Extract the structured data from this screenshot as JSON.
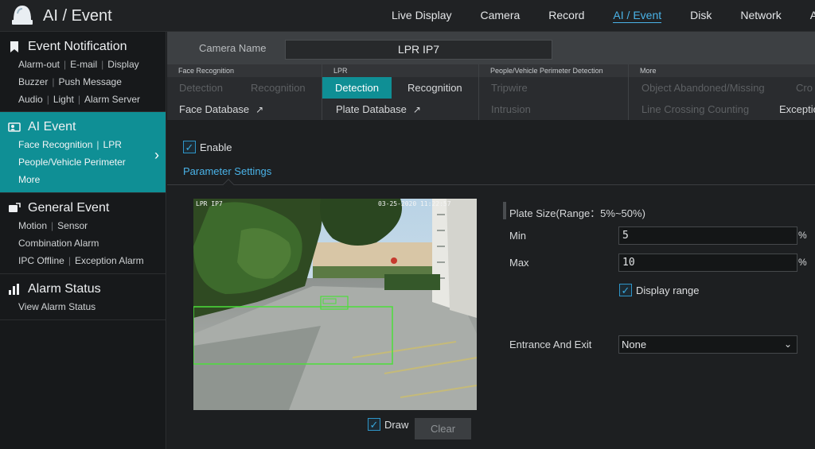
{
  "app": {
    "title": "AI / Event"
  },
  "nav": [
    {
      "label": "Live Display"
    },
    {
      "label": "Camera"
    },
    {
      "label": "Record"
    },
    {
      "label": "AI / Event",
      "active": true
    },
    {
      "label": "Disk"
    },
    {
      "label": "Network"
    },
    {
      "label": "Ac"
    }
  ],
  "sidebar": {
    "event_notification": {
      "title": "Event Notification",
      "links": [
        "Alarm-out",
        "E-mail",
        "Display",
        "Buzzer",
        "Push Message",
        "Audio",
        "Light",
        "Alarm Server"
      ]
    },
    "ai_event": {
      "title": "AI Event",
      "links": [
        "Face Recognition",
        "LPR",
        "People/Vehicle Perimeter",
        "More"
      ]
    },
    "general_event": {
      "title": "General Event",
      "links": [
        "Motion",
        "Sensor",
        "Combination Alarm",
        "IPC Offline",
        "Exception Alarm"
      ]
    },
    "alarm_status": {
      "title": "Alarm Status",
      "links": [
        "View Alarm Status"
      ]
    }
  },
  "camera": {
    "label": "Camera Name",
    "value": "LPR IP7"
  },
  "tab_groups": {
    "face": {
      "header": "Face Recognition",
      "detection": "Detection",
      "recognition": "Recognition",
      "database": "Face Database"
    },
    "lpr": {
      "header": "LPR",
      "detection": "Detection",
      "recognition": "Recognition",
      "database": "Plate Database"
    },
    "perimeter": {
      "header": "People/Vehicle Perimeter Detection",
      "tripwire": "Tripwire",
      "intrusion": "Intrusion"
    },
    "more": {
      "header": "More",
      "object": "Object Abandoned/Missing",
      "cro": "Cro",
      "line_crossing": "Line Crossing Counting",
      "exception": "Exceptio"
    }
  },
  "enable": {
    "label": "Enable",
    "checked": true
  },
  "parameter_tab": "Parameter Settings",
  "video": {
    "osd_name": "LPR IP7",
    "osd_time": "03-25-2020 11:22:57"
  },
  "draw": {
    "label": "Draw",
    "checked": true
  },
  "clear_label": "Clear",
  "settings": {
    "plate_size_title": "Plate Size(Range：5%~50%)",
    "min_label": "Min",
    "min_value": "5",
    "max_label": "Max",
    "max_value": "10",
    "percent": "%",
    "display_range_label": "Display range",
    "display_range_checked": true,
    "entrance_label": "Entrance And Exit",
    "entrance_value": "None"
  },
  "colors": {
    "accent": "#0f8f95",
    "link": "#4ab3e8",
    "detection_box": "#4cdf3a"
  }
}
